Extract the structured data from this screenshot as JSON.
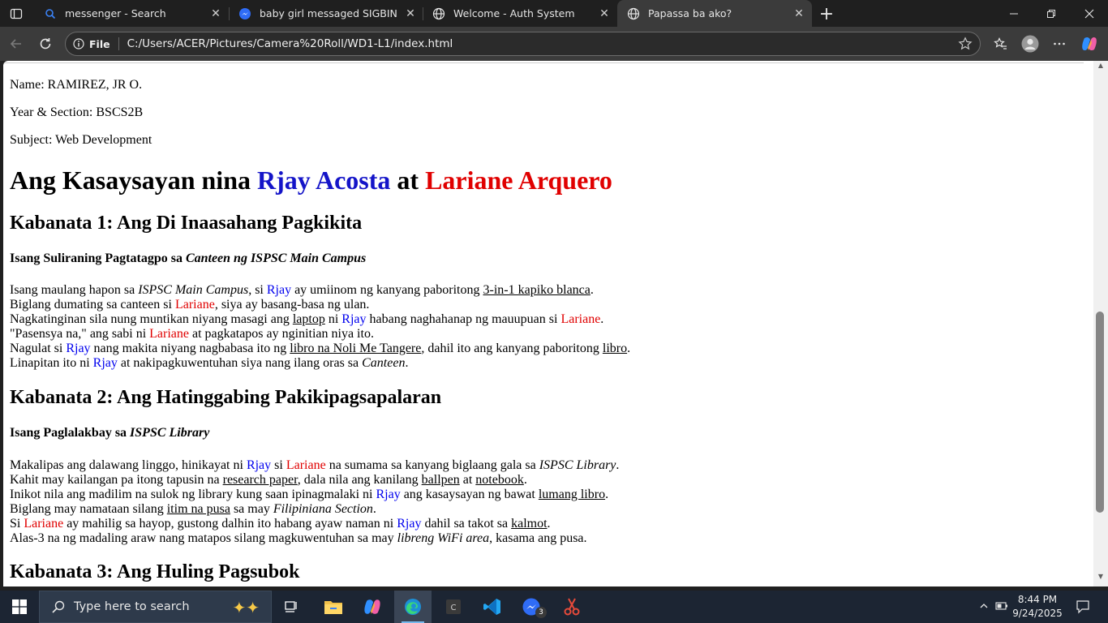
{
  "browser": {
    "tabs": [
      {
        "title": "messenger - Search",
        "icon": "search-icon"
      },
      {
        "title": "baby girl messaged SIGBIN",
        "icon": "messenger-icon"
      },
      {
        "title": "Welcome - Auth System",
        "icon": "globe-icon"
      },
      {
        "title": "Papassa ba ako?",
        "icon": "globe-icon",
        "active": true
      }
    ],
    "address": {
      "scheme_label": "File",
      "url": "C:/Users/ACER/Pictures/Camera%20Roll/WD1-L1/index.html"
    }
  },
  "page": {
    "meta": {
      "name": "Name: RAMIREZ, JR O.",
      "section": "Year & Section: BSCS2B",
      "subject": "Subject: Web Development"
    },
    "title": {
      "prefix": "Ang Kasaysayan nina ",
      "name1": "Rjay Acosta",
      "mid": " at ",
      "name2": "Lariane Arquero"
    },
    "ch1": {
      "heading": "Kabanata 1: Ang Di Inaasahang Pagkikita",
      "sub_plain": "Isang Suliraning Pagtatagpo sa ",
      "sub_italic": "Canteen ng ISPSC Main Campus",
      "l1": [
        "Isang maulang hapon sa ",
        "ISPSC Main Campus",
        ", si ",
        "Rjay",
        " ay umiinom ng kanyang paboritong ",
        "3-in-1 kapiko blanca",
        "."
      ],
      "l2": [
        "Biglang dumating sa canteen si ",
        "Lariane",
        ", siya ay basang-basa ng ulan."
      ],
      "l3": [
        "Nagkatinginan sila nung muntikan niyang masagi ang ",
        "laptop",
        " ni ",
        "Rjay",
        " habang naghahanap ng mauupuan si ",
        "Lariane",
        "."
      ],
      "l4": [
        "\"Pasensya na,\" ang sabi ni ",
        "Lariane",
        " at pagkatapos ay nginitian niya ito."
      ],
      "l5": [
        "Nagulat si ",
        "Rjay",
        " nang makita niyang nagbabasa ito ng ",
        "libro na Noli Me Tangere",
        ", dahil ito ang kanyang paboritong ",
        "libro",
        "."
      ],
      "l6": [
        "Linapitan ito ni ",
        "Rjay",
        " at nakipagkuwentuhan siya nang ilang oras sa ",
        "Canteen",
        "."
      ]
    },
    "ch2": {
      "heading": "Kabanata 2: Ang Hatinggabing Pakikipagsapalaran",
      "sub_plain": "Isang Paglalakbay sa ",
      "sub_italic": "ISPSC Library",
      "l1": [
        "Makalipas ang dalawang linggo, hinikayat ni ",
        "Rjay",
        " si ",
        "Lariane",
        " na sumama sa kanyang biglaang gala sa ",
        "ISPSC Library",
        "."
      ],
      "l2": [
        "Kahit may kailangan pa itong tapusin na ",
        "research paper",
        ", dala nila ang kanilang ",
        "ballpen",
        " at ",
        "notebook",
        "."
      ],
      "l3": [
        "Inikot nila ang madilim na sulok ng library kung saan ipinagmalaki ni ",
        "Rjay",
        " ang kasaysayan ng bawat ",
        "lumang libro",
        "."
      ],
      "l4": [
        "Biglang may namataan silang ",
        "itim na pusa",
        " sa may ",
        "Filipiniana Section",
        "."
      ],
      "l5": [
        "Si ",
        "Lariane",
        " ay mahilig sa hayop, gustong dalhin ito habang ayaw naman ni ",
        "Rjay",
        " dahil sa takot sa ",
        "kalmot",
        "."
      ],
      "l6": [
        "Alas-3 na ng madaling araw nang matapos silang magkuwentuhan sa may ",
        "libreng WiFi area",
        ", kasama ang pusa."
      ]
    },
    "ch3": {
      "heading": "Kabanata 3: Ang Huling Pagsubok"
    }
  },
  "taskbar": {
    "search_placeholder": "Type here to search",
    "messenger_badge": "3",
    "apps": [
      "task-view-icon",
      "file-explorer-icon",
      "copilot-icon",
      "edge-icon",
      "c-app-icon",
      "vscode-icon",
      "messenger-icon",
      "snipping-tool-icon"
    ],
    "time": "8:44 PM",
    "date": "9/24/2025"
  },
  "colors": {
    "rjay": "#0000ee",
    "lariane": "#e00000"
  }
}
